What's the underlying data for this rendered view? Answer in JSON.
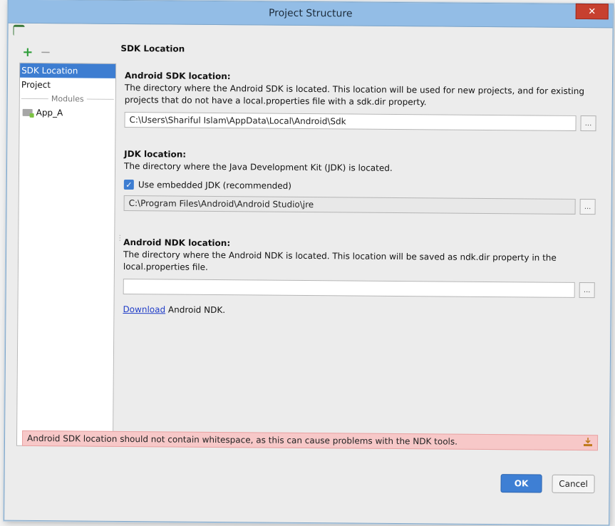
{
  "window": {
    "title": "Project Structure",
    "close_label": "✕"
  },
  "toolbar": {
    "add_symbol": "+",
    "remove_symbol": "−"
  },
  "nav": {
    "items": [
      "SDK Location",
      "Project"
    ],
    "modules_header": "Modules",
    "modules": [
      "App_A"
    ]
  },
  "panel": {
    "title": "SDK Location",
    "android_sdk": {
      "label": "Android SDK location:",
      "description": "The directory where the Android SDK is located. This location will be used for new projects, and for existing projects that do not have a local.properties file with a sdk.dir property.",
      "path": "C:\\Users\\Shariful Islam\\AppData\\Local\\Android\\Sdk",
      "browse": "..."
    },
    "jdk": {
      "label": "JDK location:",
      "description": "The directory where the Java Development Kit (JDK) is located.",
      "checkbox_label": "Use embedded JDK (recommended)",
      "checked": true,
      "path": "C:\\Program Files\\Android\\Android Studio\\jre",
      "browse": "..."
    },
    "ndk": {
      "label": "Android NDK location:",
      "description": "The directory where the Android NDK is located. This location will be saved as ndk.dir property in the local.properties file.",
      "path": "",
      "browse": "...",
      "download_link": "Download",
      "download_suffix": " Android NDK."
    }
  },
  "error": {
    "message": "Android SDK location should not contain whitespace, as this can cause problems with the NDK tools."
  },
  "buttons": {
    "ok": "OK",
    "cancel": "Cancel"
  },
  "colors": {
    "accent": "#3e7fd4",
    "error_bg": "#f7c8c8",
    "titlebar": "#93bde6"
  }
}
